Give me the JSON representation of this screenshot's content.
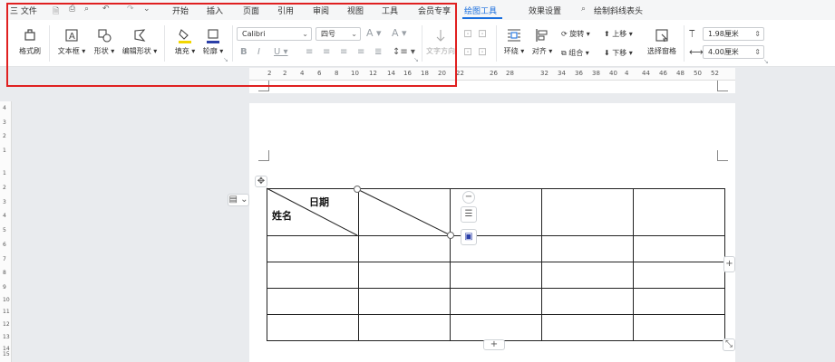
{
  "menubar": {
    "file": "三 文件",
    "tabs": [
      "开始",
      "插入",
      "页面",
      "引用",
      "审阅",
      "视图",
      "工具",
      "会员专享"
    ],
    "active_tab": "绘图工具",
    "effect_tab": "效果设置",
    "search_label": "绘制斜线表头"
  },
  "ribbon": {
    "format_painter": "格式刷",
    "textbox": "文本框",
    "shape": "形状",
    "edit_shape": "编辑形状",
    "fill": "填充",
    "outline": "轮廓",
    "font_name": "Calibri",
    "font_size": "四号",
    "text_direction": "文字方向",
    "wrap": "环绕",
    "align": "对齐",
    "rotate": "旋转",
    "group": "组合",
    "bring_forward": "上移",
    "send_backward": "下移",
    "selection_pane": "选择窗格",
    "height_value": "1.98厘米",
    "width_value": "4.00厘米",
    "fill_color": "#f2d600",
    "outline_color": "#2b3fa8"
  },
  "ruler": {
    "h_ticks": [
      "2",
      "2",
      "4",
      "6",
      "8",
      "10",
      "12",
      "14",
      "16",
      "18",
      "20",
      "22",
      "26",
      "28",
      "32",
      "34",
      "36",
      "38",
      "40",
      "4",
      "44",
      "46",
      "48",
      "50",
      "52"
    ],
    "v_ticks": [
      "4",
      "3",
      "2",
      "1",
      "1",
      "2",
      "3",
      "4",
      "5",
      "6",
      "7",
      "8",
      "9",
      "10",
      "11",
      "12",
      "13",
      "14",
      "15"
    ]
  },
  "table": {
    "header_date": "日期",
    "header_name": "姓名",
    "rows": 5,
    "cols": 5
  },
  "accent": "#1a6fde",
  "highlight_box_color": "#e02020"
}
